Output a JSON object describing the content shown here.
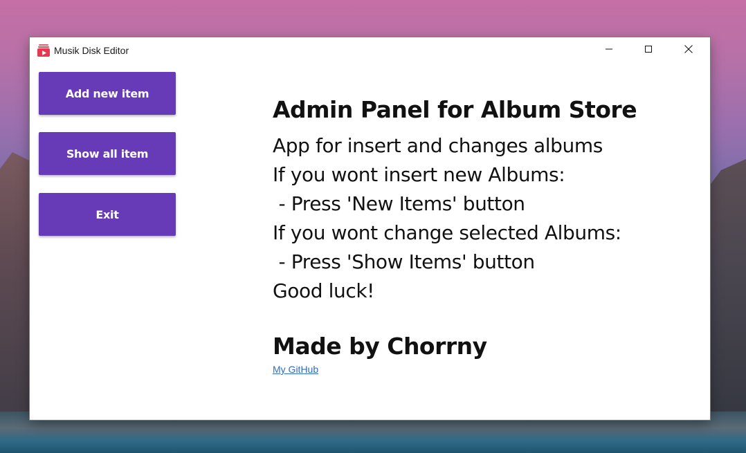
{
  "window": {
    "title": "Musik Disk Editor",
    "icon": "music-video-icon"
  },
  "titlebar_controls": {
    "minimize_icon": "minimize-icon",
    "maximize_icon": "maximize-icon",
    "close_icon": "close-icon"
  },
  "sidebar": {
    "buttons": [
      {
        "label": "Add new item"
      },
      {
        "label": "Show all item"
      },
      {
        "label": "Exit"
      }
    ],
    "accent_color": "#673ab7"
  },
  "main": {
    "heading": "Admin Panel for Album Store",
    "lines": [
      "App for insert and changes albums",
      "If you wont insert new Albums:",
      " - Press 'New Items' button",
      "If you wont change selected Albums:",
      " - Press 'Show Items' button",
      "Good luck!"
    ],
    "credit": "Made by Chorrny",
    "link_label": "My GitHub"
  }
}
